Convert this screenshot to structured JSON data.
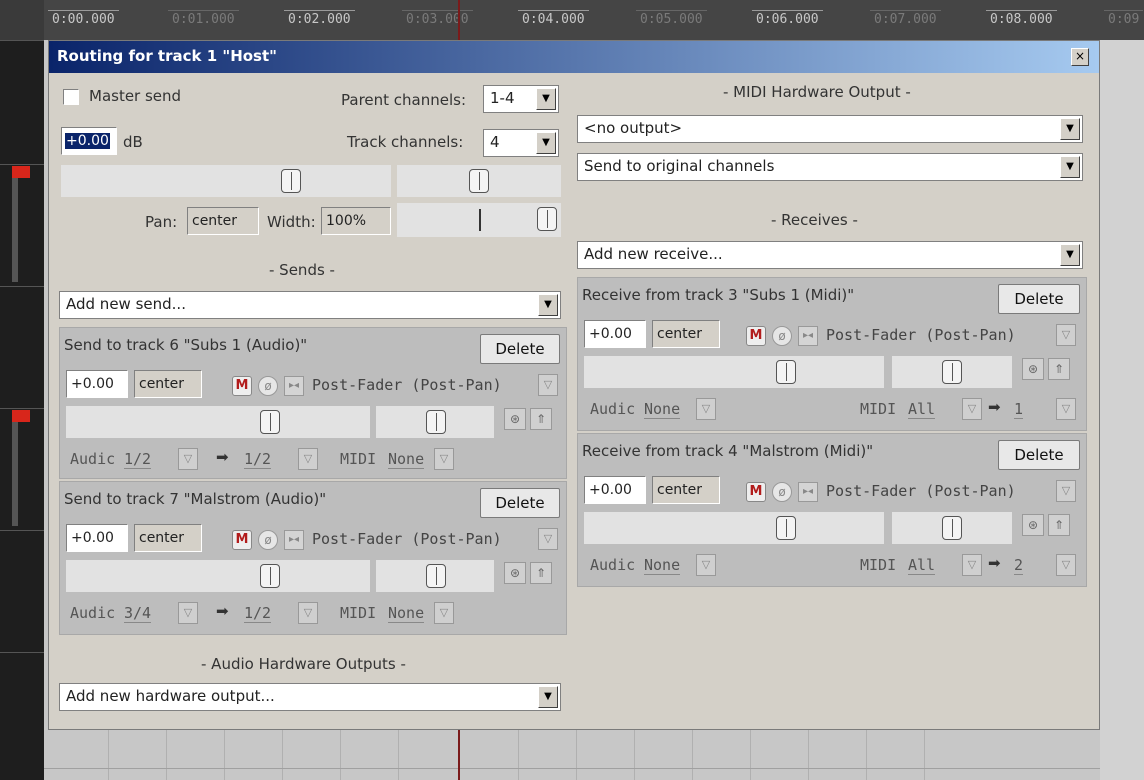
{
  "timeline": {
    "ticks": [
      "0:00.000",
      "0:01.000",
      "0:02.000",
      "0:03.000",
      "0:04.000",
      "0:05.000",
      "0:06.000",
      "0:07.000",
      "0:08.000",
      "0:09"
    ]
  },
  "dialog": {
    "title": "Routing for track 1 \"Host\"",
    "close": "×"
  },
  "master": {
    "master_send_label": "Master send",
    "parent_channels_label": "Parent channels:",
    "parent_channels_value": "1-4",
    "volume_value": "+0.00",
    "db_label": "dB",
    "track_channels_label": "Track channels:",
    "track_channels_value": "4",
    "pan_label": "Pan:",
    "pan_value": "center",
    "width_label": "Width:",
    "width_value": "100%"
  },
  "sends": {
    "section_label": "- Sends -",
    "add_new": "Add new send...",
    "items": [
      {
        "title": "Send to track 6 \"Subs 1 (Audio)\"",
        "delete": "Delete",
        "volume": "+0.00",
        "pan": "center",
        "mute": "M",
        "phase": "ø",
        "mono": "▸◂",
        "mode": "Post-Fader (Post-Pan)",
        "audio_label": "Audic",
        "audio_src": "1/2",
        "arrow": "➡",
        "audio_dst": "1/2",
        "midi_label": "MIDI",
        "midi_value": "None"
      },
      {
        "title": "Send to track 7 \"Malstrom (Audio)\"",
        "delete": "Delete",
        "volume": "+0.00",
        "pan": "center",
        "mute": "M",
        "phase": "ø",
        "mono": "▸◂",
        "mode": "Post-Fader (Post-Pan)",
        "audio_label": "Audic",
        "audio_src": "3/4",
        "arrow": "➡",
        "audio_dst": "1/2",
        "midi_label": "MIDI",
        "midi_value": "None"
      }
    ]
  },
  "hw_out": {
    "section_label": "- Audio Hardware Outputs -",
    "add_new": "Add new hardware output..."
  },
  "midi_hw": {
    "section_label": "- MIDI Hardware Output -",
    "output": "<no output>",
    "channels": "Send to original channels"
  },
  "receives": {
    "section_label": "- Receives -",
    "add_new": "Add new receive...",
    "items": [
      {
        "title": "Receive from track 3 \"Subs 1 (Midi)\"",
        "delete": "Delete",
        "volume": "+0.00",
        "pan": "center",
        "mute": "M",
        "phase": "ø",
        "mono": "▸◂",
        "mode": "Post-Fader (Post-Pan)",
        "audio_label": "Audic",
        "audio_value": "None",
        "midi_label": "MIDI",
        "midi_src": "All",
        "arrow": "➡",
        "midi_dst": "1"
      },
      {
        "title": "Receive from track 4 \"Malstrom (Midi)\"",
        "delete": "Delete",
        "volume": "+0.00",
        "pan": "center",
        "mute": "M",
        "phase": "ø",
        "mono": "▸◂",
        "mode": "Post-Fader (Post-Pan)",
        "audio_label": "Audic",
        "audio_value": "None",
        "midi_label": "MIDI",
        "midi_src": "All",
        "arrow": "➡",
        "midi_dst": "2"
      }
    ]
  },
  "icons": {
    "dropdown": "chevron-down-icon",
    "fx": "fx-icon",
    "env": "envelope-icon"
  }
}
